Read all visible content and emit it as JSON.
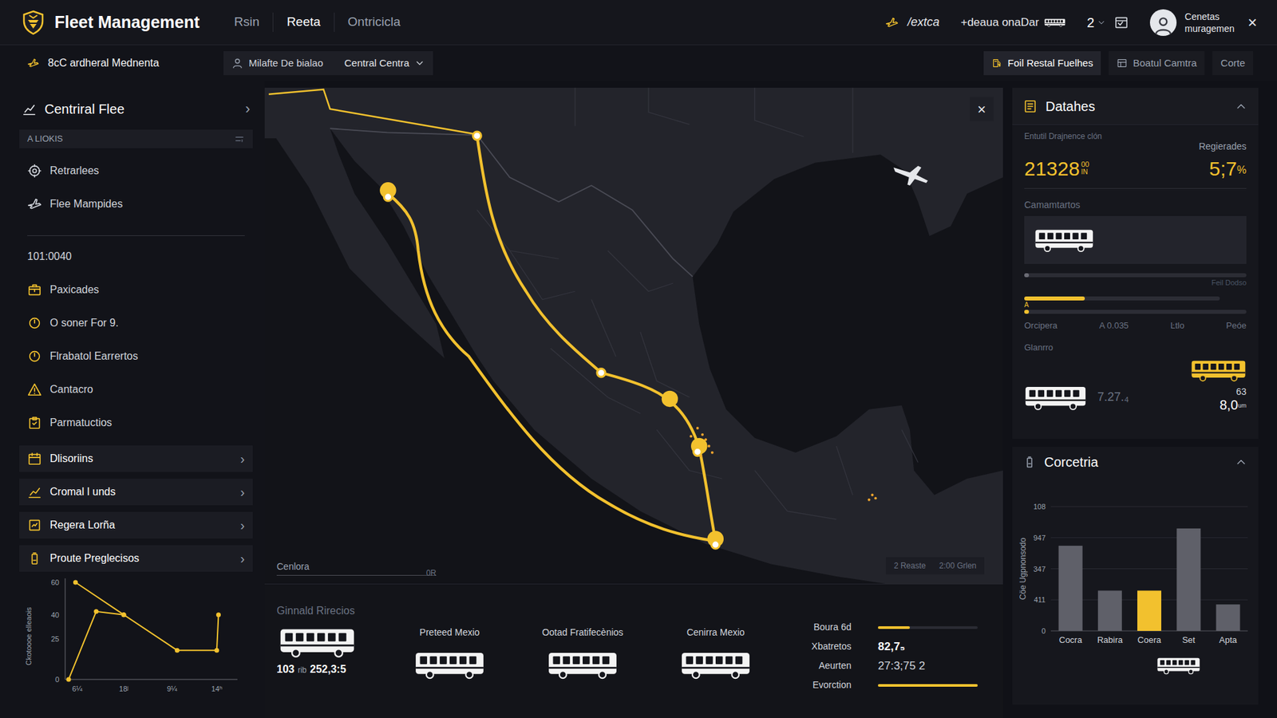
{
  "header": {
    "title": "Fleet Management",
    "nav": [
      {
        "label": "Rsin",
        "selected": false
      },
      {
        "label": "Reeta",
        "selected": true
      },
      {
        "label": "Ontricicla",
        "selected": false
      }
    ],
    "link": "/extca",
    "add": "+deaua onaDar",
    "count": "2",
    "user": [
      "Cenetas",
      "muragemen"
    ],
    "close": "×"
  },
  "subheader": {
    "org": "8cC ardheral Mednenta",
    "filter_label": "Milafte De bialao",
    "filter_value": "Central Centra",
    "actions": [
      {
        "label": "Foil Restal Fuelhes",
        "selected": true
      },
      {
        "label": "Boatul Camtra",
        "selected": false
      },
      {
        "label": "Corte",
        "selected": false
      }
    ]
  },
  "sidebar": {
    "title": "Centriral Flee",
    "title_caret": "›",
    "subheader": "A LIOKIS",
    "top_items": [
      {
        "label": "Retrarlees"
      },
      {
        "label": "Flee Mampides"
      }
    ],
    "code": "101:0040",
    "items": [
      {
        "label": "Paxicades"
      },
      {
        "label": "O soner For 9."
      },
      {
        "label": "Flrabatol Earrertos"
      },
      {
        "label": "Cantacro"
      },
      {
        "label": "Parmatuctios"
      }
    ],
    "groups": [
      {
        "label": "Dlisoriins",
        "caret": "›"
      },
      {
        "label": "Cromal l unds",
        "caret": "›"
      },
      {
        "label": "Regera Lorña",
        "caret": "›"
      },
      {
        "label": "Proute Preglecisos",
        "caret": "›"
      }
    ],
    "chart": {
      "y_label": "Ckotoooe elleaois",
      "y_max": 60,
      "y_ticks": [
        {
          "label": "60",
          "value": 60
        },
        {
          "label": "40",
          "value": 40
        },
        {
          "label": "25",
          "value": 25
        },
        {
          "label": "0",
          "value": 0
        }
      ],
      "x_ticks": [
        {
          "label": "6¼",
          "value": 7
        },
        {
          "label": "18ʲ",
          "value": 34
        },
        {
          "label": "9¼",
          "value": 62
        },
        {
          "label": "14ʰ",
          "value": 88
        }
      ],
      "series": [
        {
          "x": [
            2,
            18,
            34,
            65,
            88,
            89
          ],
          "y": [
            0,
            42,
            40,
            18,
            18,
            40
          ]
        },
        {
          "x": [
            6,
            34
          ],
          "y": [
            60,
            40
          ]
        }
      ]
    }
  },
  "map": {
    "close": "×",
    "scale_label": "Cenlora",
    "scale_end": "0R",
    "legend": [
      "2 Reaste",
      "2:00 Grlen"
    ]
  },
  "fleet": {
    "title": "Ginnald Rirecios",
    "vehicles": [
      {
        "kind": "stats",
        "value": "103",
        "unit": "rib",
        "reading": "252,3:5"
      },
      {
        "kind": "named",
        "label": "Preteed Mexio"
      },
      {
        "kind": "named",
        "label": "Ootad Fratifecènios"
      },
      {
        "kind": "named",
        "label": "Cenirra Mexio"
      }
    ],
    "metrics": [
      {
        "label": "Boura 6d",
        "kind": "bar",
        "level": 0.32
      },
      {
        "label": "Xbatretos",
        "kind": "text",
        "value": "82,7₅"
      },
      {
        "label": "Aeurten",
        "kind": "text",
        "value": "27:3;75 2"
      },
      {
        "label": "Evorction",
        "kind": "bar",
        "level": 1
      }
    ]
  },
  "details": {
    "title": "Datahes",
    "subtitle": "Entutil Drajnence clón",
    "right_label": "Regierades",
    "total": "21328",
    "total_sup": "00",
    "total_sub": "IN",
    "percent": "5;7",
    "percent_unit": "%",
    "section1": "Camamtartos",
    "tracks": [
      {
        "level": 0.02,
        "label": "Feil Dodso"
      },
      {
        "level": 0.31,
        "marker": "A"
      },
      {
        "level": 0.02
      }
    ],
    "labels": [
      "Orcipera",
      "A 0.035",
      "Ŀtlo",
      "Peóe"
    ],
    "section2": "Glanrro",
    "reading1": "7.27.₄",
    "reading2_top": "63",
    "reading2": "8,0",
    "reading2_unit": "um"
  },
  "consumption": {
    "title": "Corcetria",
    "y_label": "Cöe Ugpnonsodo",
    "y_max": 108,
    "y_ticks": [
      "108",
      "947",
      "347",
      "411",
      "0"
    ],
    "bars": [
      {
        "label": "Cocra",
        "value": 74,
        "color": "#5f6069"
      },
      {
        "label": "Rabira",
        "value": 35,
        "color": "#5f6069"
      },
      {
        "label": "Coera",
        "value": 35,
        "color": "#f2c12e"
      },
      {
        "label": "Set",
        "value": 89,
        "color": "#5f6069"
      },
      {
        "label": "Apta",
        "value": 23,
        "color": "#5f6069"
      }
    ]
  }
}
